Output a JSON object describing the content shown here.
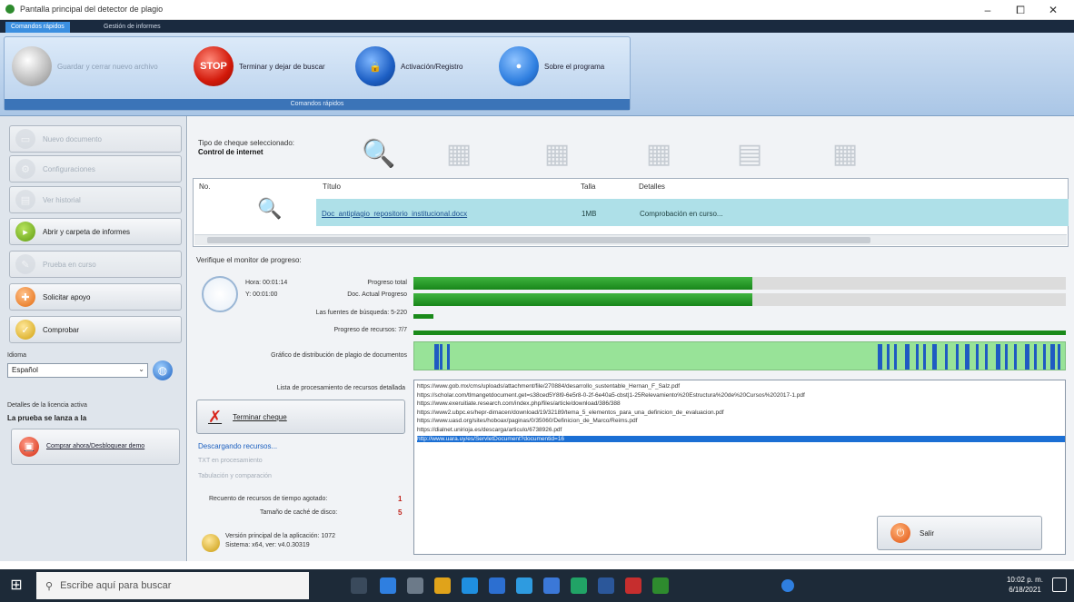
{
  "window": {
    "title": "Pantalla principal del detector de plagio",
    "controls": {
      "minimize": "–",
      "maximize": "⧠",
      "close": "✕"
    }
  },
  "ribbon_tabs": [
    "Comandos rápidos",
    "Gestión de informes"
  ],
  "ribbon": {
    "group_label": "Comandos rápidos",
    "buttons": [
      {
        "label": "Guardar y cerrar nuevo archivo",
        "icon": "disk-icon",
        "enabled": false
      },
      {
        "label": "Terminar y dejar de buscar",
        "icon": "stop-icon",
        "icon_text": "STOP",
        "enabled": true
      },
      {
        "label": "Activación/Registro",
        "icon": "lock-icon",
        "enabled": true
      },
      {
        "label": "Sobre el programa",
        "icon": "info-icon",
        "enabled": true
      }
    ]
  },
  "left_nav": [
    {
      "label": "Nuevo documento",
      "icon": "document-icon",
      "enabled": false
    },
    {
      "label": "Configuraciones",
      "icon": "settings-icon",
      "enabled": false
    },
    {
      "label": "Ver historial",
      "icon": "history-icon",
      "enabled": false
    },
    {
      "label": "Abrir y carpeta de informes",
      "icon": "folder-icon",
      "enabled": true
    },
    {
      "label": "Prueba en curso",
      "icon": "pencil-icon",
      "enabled": false
    },
    {
      "label": "Solicitar apoyo",
      "icon": "support-icon",
      "enabled": true
    },
    {
      "label": "Comprobar",
      "icon": "check-icon",
      "enabled": true
    }
  ],
  "language": {
    "label": "Idioma",
    "value": "Español"
  },
  "license": {
    "label": "Detalles de la licencia activa",
    "value": "La prueba se lanza a la",
    "button": "Comprar ahora/Desbloquear demo"
  },
  "check_type": {
    "label": "Tipo de cheque seleccionado:",
    "value": "Control de internet"
  },
  "table": {
    "headers": {
      "no": "No.",
      "title": "Título",
      "size": "Talla",
      "details": "Detalles"
    },
    "rows": [
      {
        "title": "Doc_antiplagio_repositorio_institucional.docx",
        "size": "1MB",
        "details": "Comprobación en curso..."
      }
    ]
  },
  "progress": {
    "title": "Verifique el monitor de progreso:",
    "time_label": "Hora: 00:01:14",
    "eta_label": "Y: 00:01:00",
    "total_label": "Progreso total",
    "doc_label": "Doc. Actual Progreso",
    "sources_label": "Las fuentes de búsqueda: 5-220",
    "resources_label": "Progreso de recursos: 7/7",
    "dist_label": "Gráfico de distribución de plagio de documentos",
    "total_fraction": 0.52,
    "doc_fraction": 0.52,
    "sources_fraction": 0.03,
    "resources_fraction": 1.0
  },
  "sources": {
    "label": "Lista de procesamiento de recursos detallada",
    "items": [
      "https://www.gob.mx/cms/uploads/attachment/file/270884/desarrollo_sustentable_Hernan_F_Salz.pdf",
      "https://scholar.com/tlmangetdocument.get=s38ced5Y8l9-6e5r8-0-2f-6e40a5-cbst|1-25Relevamiento%20Estructura%20de%20Cursos%202017-1.pdf",
      "https://www.exeruitiate.research.com/index.php/files/article/download/386/388",
      "https://www2.ubpc.es/hepr-dimacen/download/19/32189/tema_5_elementos_para_una_definicion_de_evaluacion.pdf",
      "https://www.uasd.org/sites/hoboax/paginas/0/35060/Definicion_de_Marco/Reims.pdf",
      "https://dialnet.unirioja.es/descarga/articulo/6738926.pdf",
      "http://www.uara.uy/es/ServletDocument?documentid=16"
    ],
    "selected_index": 6
  },
  "stop_button": "Terminar cheque",
  "status": {
    "line1": "Descargando recursos...",
    "line2": "TXT en procesamiento",
    "line3": "Tabulación y comparación"
  },
  "stats": [
    {
      "label": "Recuento de recursos de tiempo agotado:",
      "value": "1"
    },
    {
      "label": "Tamaño de caché de disco:",
      "value": "5"
    }
  ],
  "app_version": {
    "line1": "Versión principal de la aplicación: 1072",
    "line2": "Sistema: x64, ver: v4.0.30319"
  },
  "exit_button": "Salir",
  "taskbar": {
    "search_placeholder": "Escribe aquí para buscar",
    "time": "10:02 p. m.",
    "date": "6/18/2021"
  },
  "colors": {
    "progress_green": "#18861a",
    "dist_bg": "#98e398",
    "dist_stripe": "#1f5bc2",
    "row_highlight": "#aee0e8",
    "selection_blue": "#1b6fd4"
  }
}
